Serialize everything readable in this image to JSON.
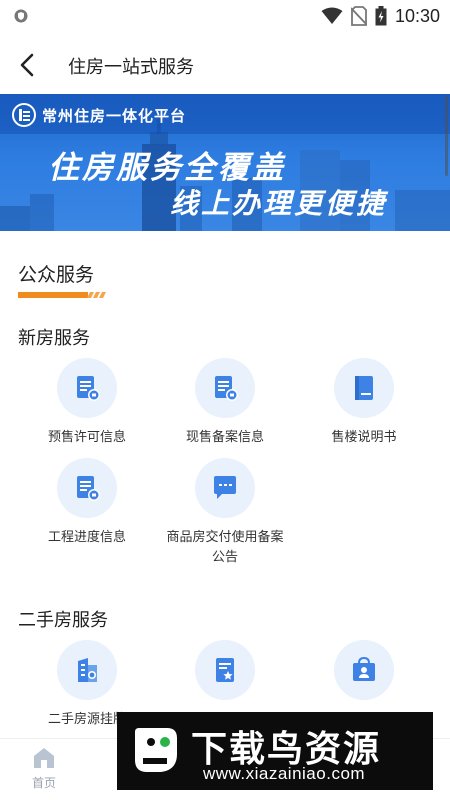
{
  "status_bar": {
    "time": "10:30"
  },
  "header": {
    "back_icon": "chevron-left-icon",
    "title": "住房一站式服务"
  },
  "banner": {
    "platform_name": "常州住房一体化平台",
    "slogan_line1": "住房服务全覆盖",
    "slogan_line2": "线上办理更便捷"
  },
  "public_services": {
    "title": "公众服务",
    "accent_color": "#f08c1e"
  },
  "new_house": {
    "title": "新房服务",
    "items": [
      {
        "label": "预售许可信息",
        "icon": "document-stamp-icon"
      },
      {
        "label": "现售备案信息",
        "icon": "document-stamp-icon"
      },
      {
        "label": "售楼说明书",
        "icon": "book-icon"
      },
      {
        "label": "工程进度信息",
        "icon": "document-stamp-icon"
      },
      {
        "label": "商品房交付使用备案公告",
        "icon": "chat-bubble-icon"
      }
    ]
  },
  "second_hand": {
    "title": "二手房服务",
    "items": [
      {
        "label": "二手房源挂牌",
        "icon": "building-icon"
      },
      {
        "label": "",
        "icon": "certificate-star-icon"
      },
      {
        "label": "",
        "icon": "bag-user-icon"
      }
    ]
  },
  "tabbar": {
    "home_label": "首页"
  },
  "watermark": {
    "title": "下载鸟资源",
    "url": "www.xiazainiao.com"
  },
  "colors": {
    "primary": "#2a78de",
    "icon_bg": "#e8f1fc",
    "icon_fg": "#3d82e4"
  }
}
